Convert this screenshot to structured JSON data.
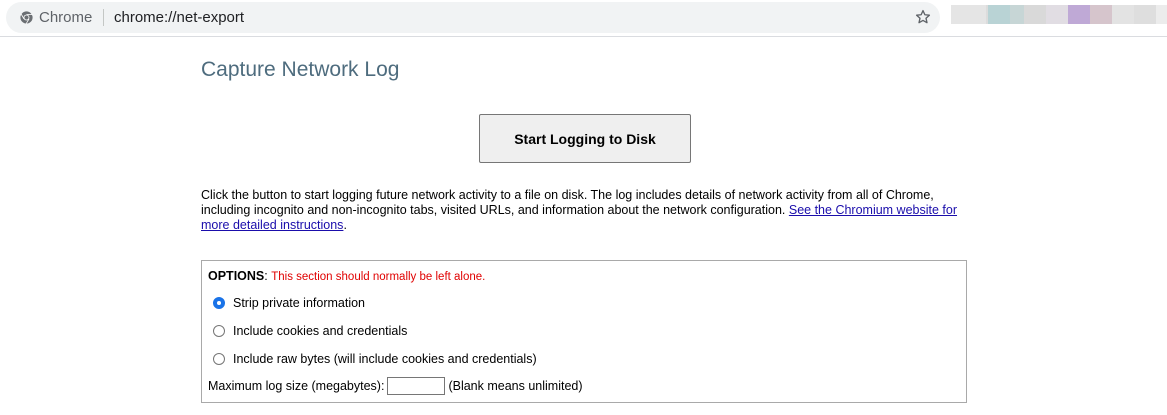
{
  "browser": {
    "site_label": "Chrome",
    "url": "chrome://net-export",
    "extension_colors": [
      "#e5e5e5",
      "#dcdcdc",
      "#b9d3d5",
      "#c7d6d6",
      "#d9d9d9",
      "#e1dde3",
      "#bfa9d6",
      "#d6c5cc",
      "#e3e3e3",
      "#dedede",
      "#ececec"
    ]
  },
  "page": {
    "title": "Capture Network Log",
    "start_button_label": "Start Logging to Disk",
    "description_text": "Click the button to start logging future network activity to a file on disk. The log includes details of network activity from all of Chrome, including incognito and non-incognito tabs, visited URLs, and information about the network configuration. ",
    "description_link": "See the Chromium website for more detailed instructions",
    "description_end": "."
  },
  "options": {
    "label": "OPTIONS",
    "separator": ": ",
    "note": "This section should normally be left alone.",
    "choices": [
      {
        "label": "Strip private information",
        "checked": true
      },
      {
        "label": "Include cookies and credentials",
        "checked": false
      },
      {
        "label": "Include raw bytes (will include cookies and credentials)",
        "checked": false
      }
    ],
    "max_size_label": "Maximum log size (megabytes):",
    "max_size_value": "",
    "max_size_hint": "(Blank means unlimited)"
  }
}
